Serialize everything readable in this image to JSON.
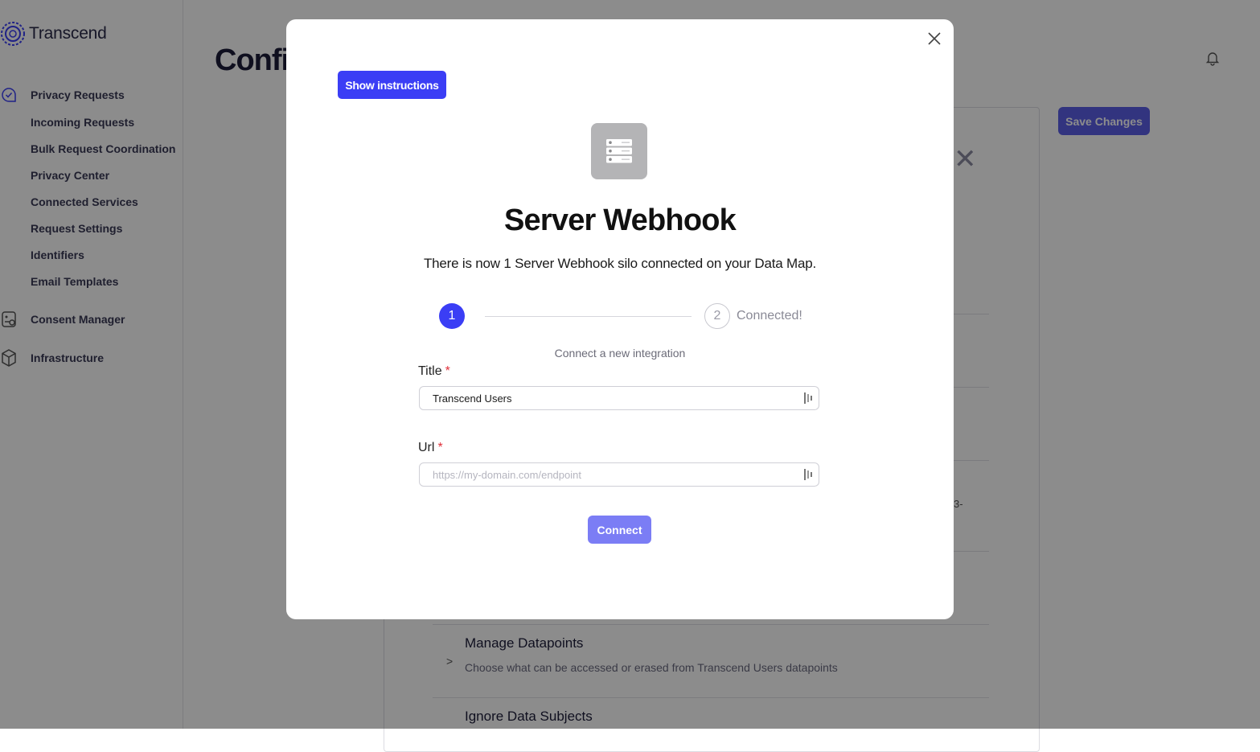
{
  "sidebar": {
    "logo": "Transcend",
    "groups": [
      {
        "label": "Privacy Requests",
        "icon": "chat-check-icon"
      },
      {
        "label": "Consent Manager",
        "icon": "consent-icon"
      },
      {
        "label": "Infrastructure",
        "icon": "cube-icon"
      }
    ],
    "items": [
      "Incoming Requests",
      "Bulk Request Coordination",
      "Privacy Center",
      "Connected Services",
      "Request Settings",
      "Identifiers",
      "Email Templates"
    ]
  },
  "main": {
    "title": "Confi",
    "save_label": "Save Changes",
    "truncated": "3-",
    "sections": [
      {
        "title": "Manage Datapoints",
        "desc": "Choose what can be accessed or erased from Transcend Users datapoints"
      },
      {
        "title": "Ignore Data Subjects"
      }
    ]
  },
  "modal": {
    "instructions_label": "Show instructions",
    "icon": "server-icon",
    "title": "Server Webhook",
    "subtitle": "There is now 1 Server Webhook silo connected on your Data Map.",
    "steps": [
      {
        "number": "1"
      },
      {
        "number": "2",
        "label": "Connected!"
      }
    ],
    "caption": "Connect a new integration",
    "fields": {
      "title": {
        "label": "Title",
        "required": "*",
        "value": "Transcend Users"
      },
      "url": {
        "label": "Url",
        "required": "*",
        "value": "",
        "placeholder": "https://my-domain.com/endpoint"
      }
    },
    "connect_label": "Connect"
  },
  "colors": {
    "accent": "#3b3ef5",
    "accent_disabled": "#7b7df5",
    "required": "#e0303a"
  }
}
